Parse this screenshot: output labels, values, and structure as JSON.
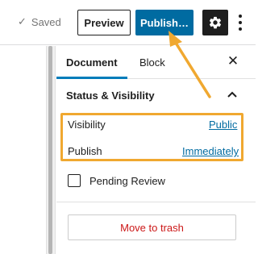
{
  "toolbar": {
    "saved_label": "Saved",
    "preview_label": "Preview",
    "publish_label": "Publish…"
  },
  "sidebar": {
    "tabs": [
      {
        "label": "Document",
        "active": true
      },
      {
        "label": "Block",
        "active": false
      }
    ],
    "panel": {
      "title": "Status & Visibility",
      "rows": [
        {
          "label": "Visibility",
          "value": "Public"
        },
        {
          "label": "Publish",
          "value": "Immediately"
        }
      ],
      "pending_review_label": "Pending Review",
      "pending_review_checked": false,
      "trash_label": "Move to trash"
    }
  },
  "icons": {
    "saved": "check-icon",
    "settings": "gear-icon",
    "more": "vertical-ellipsis-icon",
    "close": "close-icon",
    "collapse": "chevron-up-icon"
  },
  "colors": {
    "primary": "#006ba1",
    "tab_accent": "#007cba",
    "annotation": "#f0a830",
    "danger": "#cc1818",
    "dark": "#1e1e1e"
  }
}
